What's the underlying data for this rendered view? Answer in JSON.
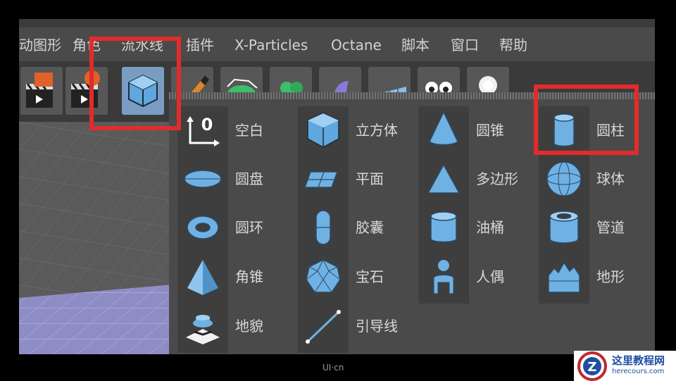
{
  "menubar": {
    "items": [
      "动图形",
      "角色",
      "流水线",
      "插件",
      "X-Particles",
      "Octane",
      "脚本",
      "窗口",
      "帮助"
    ]
  },
  "toolbar": {
    "buttons": [
      "clapper-orange-icon",
      "clapper-gear-icon",
      "cube-icon",
      "pen-icon",
      "spline-icon",
      "cloner-icon",
      "deformer-icon",
      "plane-grid-icon",
      "eyes-icon",
      "light-icon"
    ]
  },
  "popup": {
    "columns": [
      {
        "items": [
          {
            "label": "空白",
            "icon": "null-object-icon"
          },
          {
            "label": "圆盘",
            "icon": "disc-icon"
          },
          {
            "label": "圆环",
            "icon": "torus-icon"
          },
          {
            "label": "角锥",
            "icon": "pyramid-icon"
          },
          {
            "label": "地貌",
            "icon": "landscape-icon"
          }
        ]
      },
      {
        "items": [
          {
            "label": "立方体",
            "icon": "cube-icon"
          },
          {
            "label": "平面",
            "icon": "plane-icon"
          },
          {
            "label": "胶囊",
            "icon": "capsule-icon"
          },
          {
            "label": "宝石",
            "icon": "gem-icon"
          },
          {
            "label": "引导线",
            "icon": "guide-line-icon"
          }
        ]
      },
      {
        "items": [
          {
            "label": "圆锥",
            "icon": "cone-icon"
          },
          {
            "label": "多边形",
            "icon": "polygon-icon"
          },
          {
            "label": "油桶",
            "icon": "oil-tank-icon"
          },
          {
            "label": "人偶",
            "icon": "figure-icon"
          }
        ]
      },
      {
        "items": [
          {
            "label": "圆柱",
            "icon": "cylinder-icon"
          },
          {
            "label": "球体",
            "icon": "sphere-icon"
          },
          {
            "label": "管道",
            "icon": "tube-icon"
          },
          {
            "label": "地形",
            "icon": "terrain-icon"
          }
        ]
      }
    ]
  },
  "watermark": {
    "text": "UI·cn"
  },
  "brand": {
    "title": "这里教程网",
    "url": "herecours.com"
  },
  "colors": {
    "highlight": "#e22b2b",
    "icon_blue": "#7fb8e6"
  }
}
